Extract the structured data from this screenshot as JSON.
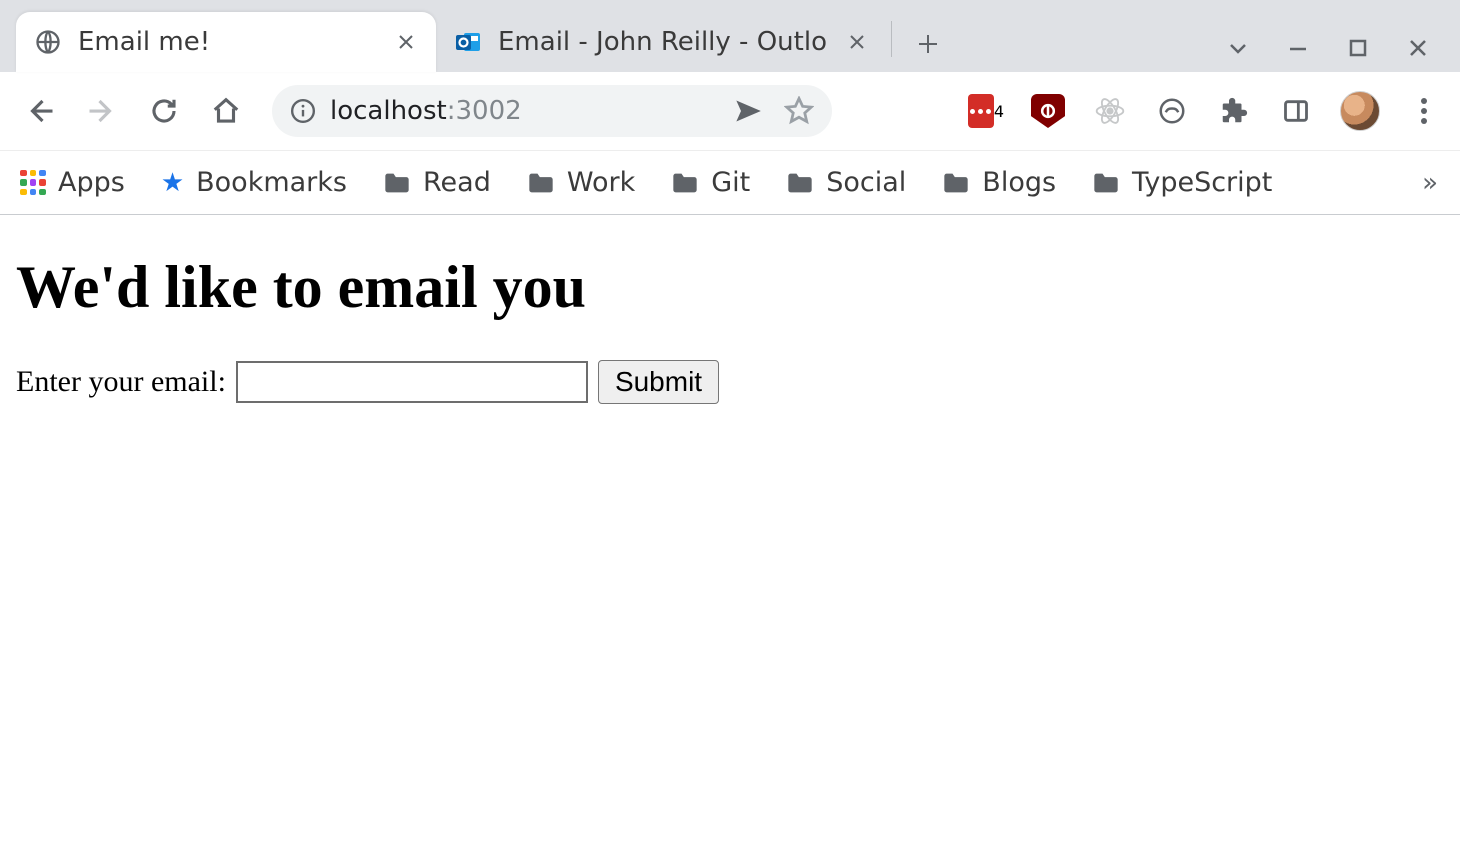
{
  "window": {
    "tabs": [
      {
        "title": "Email me!",
        "active": true
      },
      {
        "title": "Email - John Reilly - Outlo",
        "active": false
      }
    ]
  },
  "toolbar": {
    "url_host": "localhost",
    "url_port": ":3002",
    "lastpass_badge": "4"
  },
  "bookmarks": {
    "apps_label": "Apps",
    "items": [
      {
        "label": "Bookmarks",
        "icon": "star"
      },
      {
        "label": "Read",
        "icon": "folder"
      },
      {
        "label": "Work",
        "icon": "folder"
      },
      {
        "label": "Git",
        "icon": "folder"
      },
      {
        "label": "Social",
        "icon": "folder"
      },
      {
        "label": "Blogs",
        "icon": "folder"
      },
      {
        "label": "TypeScript",
        "icon": "folder"
      }
    ],
    "overflow": "»"
  },
  "page": {
    "heading": "We'd like to email you",
    "form": {
      "label": "Enter your email:",
      "input_value": "",
      "submit_label": "Submit"
    }
  }
}
